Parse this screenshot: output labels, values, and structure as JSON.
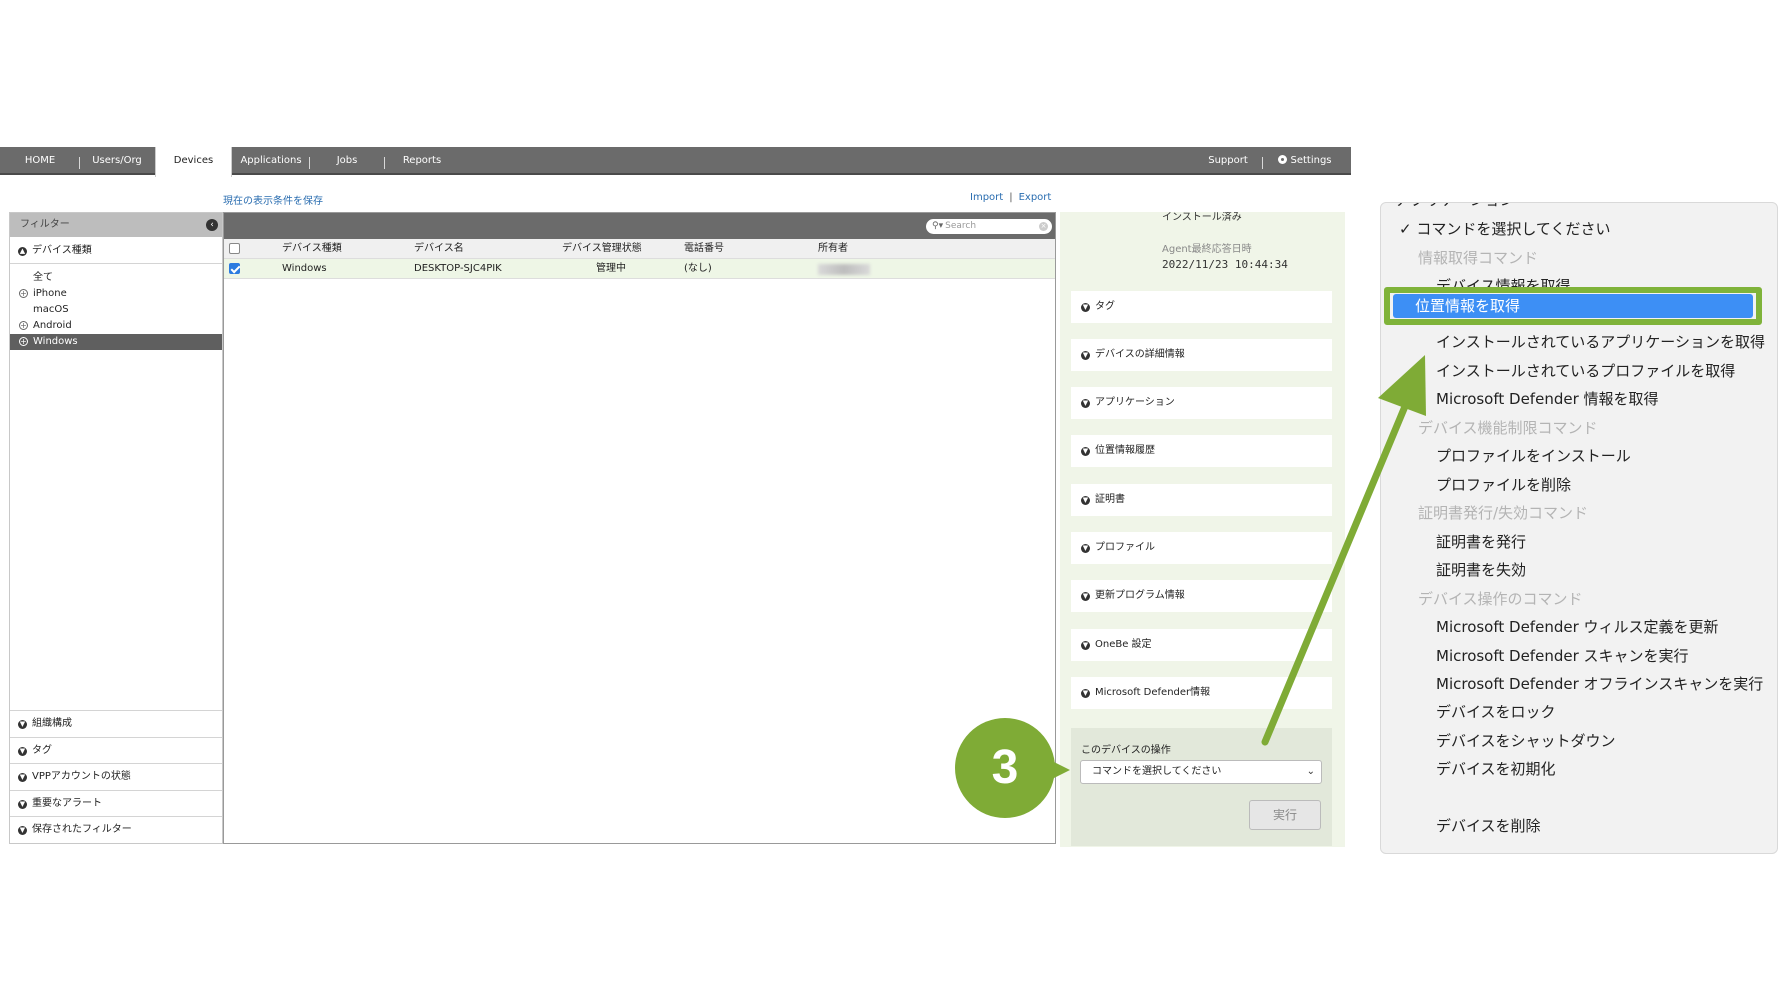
{
  "nav": {
    "home": "HOME",
    "users": "Users/Org",
    "devices": "Devices",
    "applications": "Applications",
    "jobs": "Jobs",
    "reports": "Reports",
    "support": "Support",
    "settings": "Settings"
  },
  "toolbar": {
    "save_filter": "現在の表示条件を保存",
    "import": "Import",
    "separator": "|",
    "export": "Export"
  },
  "filter": {
    "title": "フィルター",
    "collapse_glyph": "‹",
    "device_type_label": "デバイス種類",
    "types": [
      {
        "label": "全て"
      },
      {
        "label": "iPhone"
      },
      {
        "label": "macOS"
      },
      {
        "label": "Android"
      },
      {
        "label": "Windows"
      }
    ],
    "sections": [
      {
        "label": "組織構成"
      },
      {
        "label": "タグ"
      },
      {
        "label": "VPPアカウントの状態"
      },
      {
        "label": "重要なアラート"
      },
      {
        "label": "保存されたフィルター"
      }
    ]
  },
  "table": {
    "search_placeholder": "Search",
    "columns": [
      "デバイス種類",
      "デバイス名",
      "デバイス管理状態",
      "電話番号",
      "所有者"
    ],
    "rows": [
      {
        "type": "Windows",
        "name": "DESKTOP-SJC4PIK",
        "status": "管理中",
        "phone": "(なし)",
        "owner": ""
      }
    ]
  },
  "detail": {
    "install_status": "インストール済み",
    "agent_label": "Agent最終応答日時",
    "agent_date": "2022/11/23 10:44:34",
    "accordions": [
      {
        "label": "タグ"
      },
      {
        "label": "デバイスの詳細情報"
      },
      {
        "label": "アプリケーション"
      },
      {
        "label": "位置情報履歴"
      },
      {
        "label": "証明書"
      },
      {
        "label": "プロファイル"
      },
      {
        "label": "更新プログラム情報"
      },
      {
        "label": "OneBe 設定"
      },
      {
        "label": "Microsoft Defender情報"
      }
    ],
    "ops_title": "このデバイスの操作",
    "select_value": "コマンドを選択してください",
    "run_label": "実行"
  },
  "badge": {
    "number": "3"
  },
  "menu": {
    "partial_top": "アプリケーション",
    "selected": "コマンドを選択してください",
    "highlighted": "位置情報を取得",
    "items": [
      {
        "label": "情報取得コマンド",
        "group": true
      },
      {
        "label": "デバイス情報を取得",
        "group": false
      },
      {
        "label": "インストールされているアプリケーションを取得",
        "group": false
      },
      {
        "label": "インストールされているプロファイルを取得",
        "group": false
      },
      {
        "label": "Microsoft Defender 情報を取得",
        "group": false
      },
      {
        "label": "デバイス機能制限コマンド",
        "group": true
      },
      {
        "label": "プロファイルをインストール",
        "group": false
      },
      {
        "label": "プロファイルを削除",
        "group": false
      },
      {
        "label": "証明書発行/失効コマンド",
        "group": true
      },
      {
        "label": "証明書を発行",
        "group": false
      },
      {
        "label": "証明書を失効",
        "group": false
      },
      {
        "label": "デバイス操作のコマンド",
        "group": true
      },
      {
        "label": "Microsoft Defender ウィルス定義を更新",
        "group": false
      },
      {
        "label": "Microsoft Defender スキャンを実行",
        "group": false
      },
      {
        "label": "Microsoft Defender オフラインスキャンを実行",
        "group": false
      },
      {
        "label": "デバイスをロック",
        "group": false
      },
      {
        "label": "デバイスをシャットダウン",
        "group": false
      },
      {
        "label": "デバイスを初期化",
        "group": false
      },
      {
        "label": "デバイスを削除",
        "group": false
      }
    ]
  },
  "colors": {
    "nav_bg": "#6b6b6b",
    "accent_green": "#7fab36",
    "highlight_blue": "#3d8ff5",
    "link_blue": "#2a6db0"
  }
}
